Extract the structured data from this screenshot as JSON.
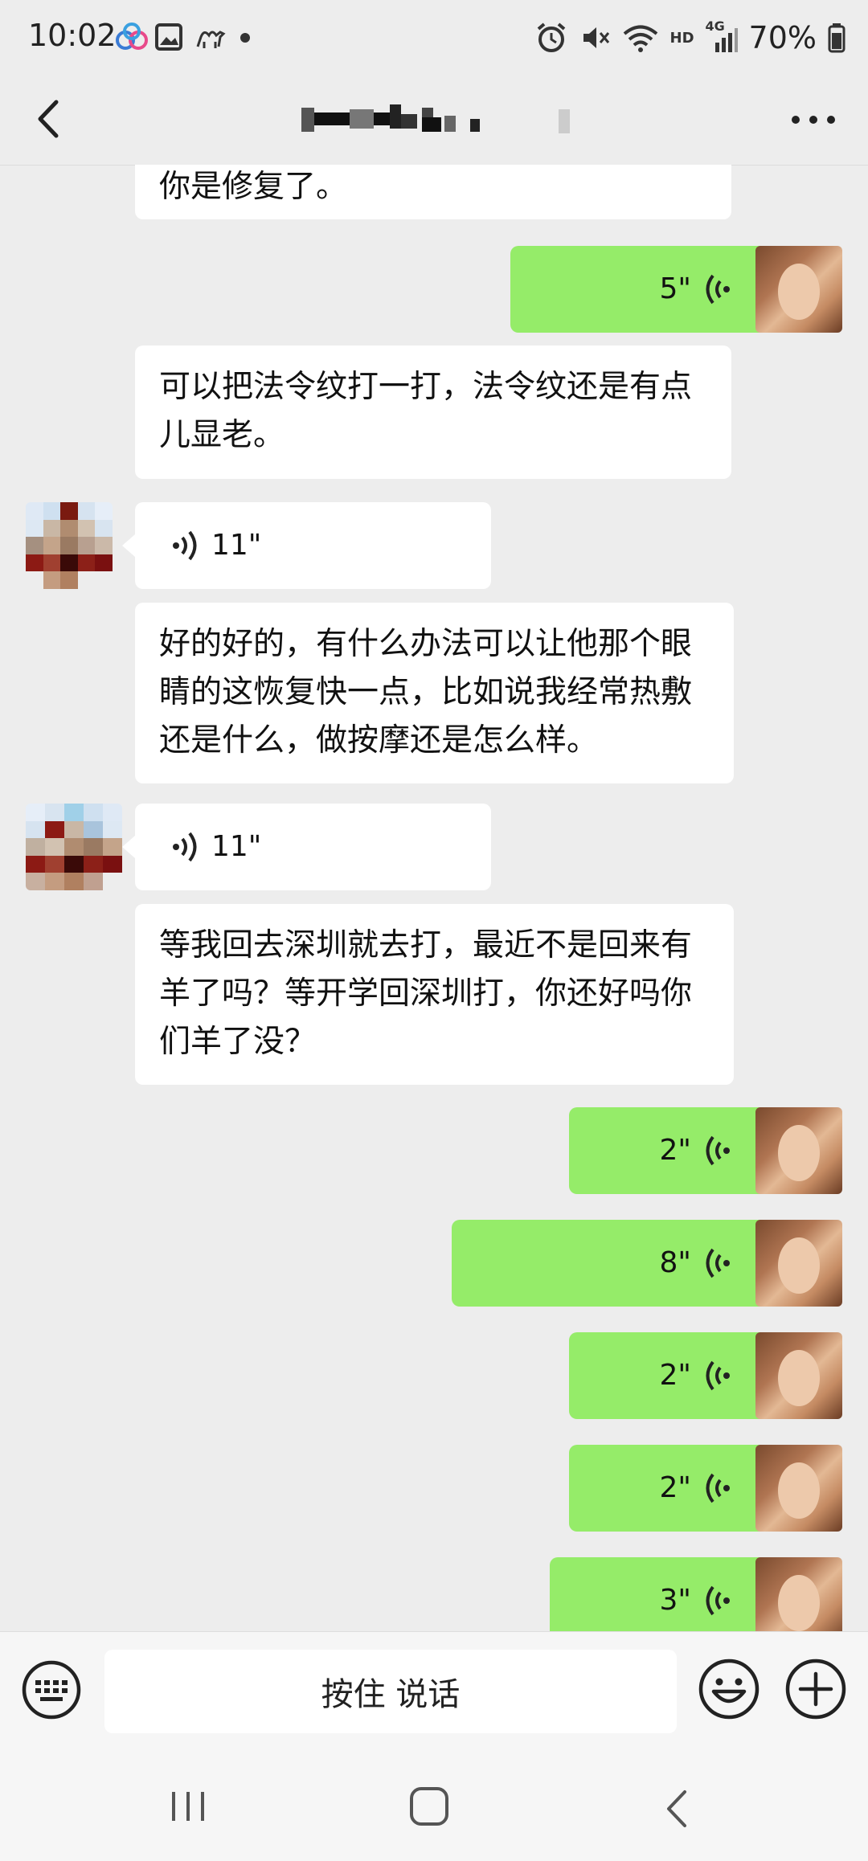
{
  "status_bar": {
    "time": "10:02",
    "battery": "70%",
    "network": "4G",
    "hd": "HD"
  },
  "header": {
    "title": ""
  },
  "messages": [
    {
      "side": "left",
      "kind": "text",
      "text": "你是修复了。"
    },
    {
      "side": "right",
      "kind": "voice",
      "duration": "5\""
    },
    {
      "side": "left",
      "kind": "text",
      "text": "可以把法令纹打一打，法令纹还是有点儿显老。"
    },
    {
      "side": "left",
      "kind": "voice",
      "duration": "11\""
    },
    {
      "side": "left",
      "kind": "text",
      "text": "好的好的，有什么办法可以让他那个眼睛的这恢复快一点，比如说我经常热敷还是什么，做按摩还是怎么样。"
    },
    {
      "side": "left",
      "kind": "voice",
      "duration": "11\""
    },
    {
      "side": "left",
      "kind": "text",
      "text": "等我回去深圳就去打，最近不是回来有羊了吗？等开学回深圳打，你还好吗你们羊了没？"
    },
    {
      "side": "right",
      "kind": "voice",
      "duration": "2\""
    },
    {
      "side": "right",
      "kind": "voice",
      "duration": "8\""
    },
    {
      "side": "right",
      "kind": "voice",
      "duration": "2\""
    },
    {
      "side": "right",
      "kind": "voice",
      "duration": "2\""
    },
    {
      "side": "right",
      "kind": "voice",
      "duration": "3\""
    }
  ],
  "input_bar": {
    "hold_to_talk": "按住 说话"
  },
  "colors": {
    "background": "#ededed",
    "my_bubble": "#95ec69",
    "their_bubble": "#ffffff"
  }
}
